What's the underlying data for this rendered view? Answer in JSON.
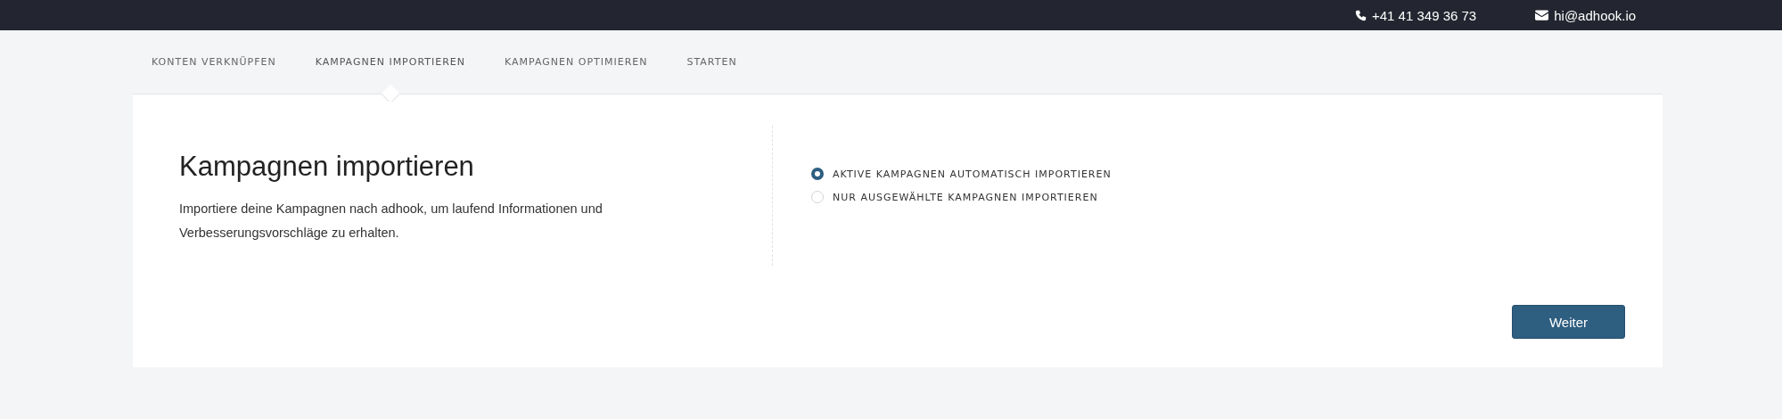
{
  "topbar": {
    "phone": "+41 41 349 36 73",
    "email": "hi@adhook.io"
  },
  "tabs": [
    {
      "label": "KONTEN VERKNÜPFEN",
      "selected": false
    },
    {
      "label": "KAMPAGNEN IMPORTIEREN",
      "selected": true
    },
    {
      "label": "KAMPAGNEN OPTIMIEREN",
      "selected": false
    },
    {
      "label": "STARTEN",
      "selected": false
    }
  ],
  "heading": "Kampagnen importieren",
  "description": "Importiere deine Kampagnen nach adhook, um laufend Informationen und Verbesserungsvorschläge zu erhalten.",
  "options": [
    {
      "label": "AKTIVE KAMPAGNEN AUTOMATISCH IMPORTIEREN",
      "selected": true
    },
    {
      "label": "NUR AUSGEWÄHLTE KAMPAGNEN IMPORTIEREN",
      "selected": false
    }
  ],
  "button": "Weiter"
}
